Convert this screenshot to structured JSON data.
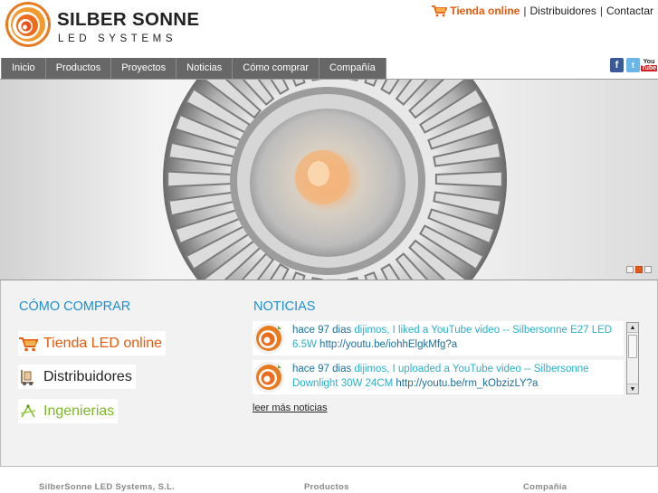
{
  "header": {
    "logo_title": "SILBER SONNE",
    "logo_subtitle": "LED SYSTEMS",
    "links": {
      "shop": "Tienda online",
      "distributors": "Distribuidores",
      "contact": "Contactar",
      "separator": "|"
    }
  },
  "nav": {
    "items": [
      {
        "label": "Inicio"
      },
      {
        "label": "Productos"
      },
      {
        "label": "Proyectos"
      },
      {
        "label": "Noticias"
      },
      {
        "label": "Cómo comprar"
      },
      {
        "label": "Compañía"
      }
    ]
  },
  "social": {
    "facebook_glyph": "f",
    "twitter_glyph": "t",
    "youtube_you": "You",
    "youtube_tube": "Tube"
  },
  "slider": {
    "slides": 3,
    "active_index": 1
  },
  "comprar": {
    "title": "CÓMO COMPRAR",
    "links": [
      {
        "label": "Tienda LED online",
        "icon": "cart-icon"
      },
      {
        "label": "Distribuidores",
        "icon": "forklift-icon"
      },
      {
        "label": "Ingenierias",
        "icon": "compass-icon"
      }
    ]
  },
  "noticias": {
    "title": "NOTICIAS",
    "items": [
      {
        "time": "hace 97 dias",
        "text": " dijimos, I liked a YouTube video -- Silbersonne E27 LED 6.5W ",
        "url": "http://youtu.be/iohhElgkMfg?a"
      },
      {
        "time": "hace 97 dias",
        "text": " dijimos, I uploaded a YouTube video -- Silbersonne Downlight 30W 24CM ",
        "url": "http://youtu.be/rm_kObzizLY?a"
      }
    ],
    "more": "leer más noticias"
  },
  "footer": {
    "company": "SilberSonne LED Systems, S.L.",
    "products": "Productos",
    "about": "Compañía"
  },
  "colors": {
    "accent_orange": "#e85a0c",
    "title_blue": "#1e8fd0",
    "nav_gray": "#676767",
    "news_teal": "#2ab0c8",
    "ing_green": "#7ab828"
  }
}
